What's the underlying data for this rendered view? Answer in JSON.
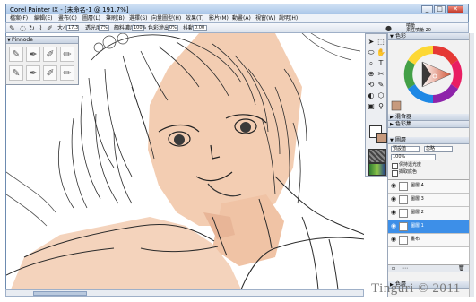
{
  "window": {
    "title": "Corel Painter IX - [未命名-1 @ 191.7%]",
    "controls": [
      "_",
      "□",
      "✕"
    ]
  },
  "menubar": {
    "items": [
      "檔案(F)",
      "編輯(E)",
      "畫布(C)",
      "圖層(L)",
      "筆刷(B)",
      "選擇(S)",
      "向量圖型(H)",
      "效果(T)",
      "影片(M)",
      "動畫(A)",
      "視窗(W)",
      "說明(H)"
    ]
  },
  "property_bar": {
    "size_label": "大小",
    "size_value": "17.3",
    "opacity_label": "透光度",
    "opacity_value": "7%",
    "resat_label": "顏料濃度",
    "resat_value": "100%",
    "bleed_label": "色彩滲出",
    "bleed_value": "0%",
    "jitter_label": "抖動",
    "jitter_value": "0.00",
    "brush_category": "噴槍",
    "brush_variant": "柔性噴槍 20"
  },
  "brush_panel": {
    "title": "Pinnode",
    "cells": [
      "✎",
      "✒",
      "✐",
      "✏",
      "✎",
      "✒",
      "✐",
      "✏"
    ]
  },
  "toolbox": {
    "tools": [
      "➤",
      "⬚",
      "⬭",
      "✋",
      "⌕",
      "T",
      "⊕",
      "✂",
      "⟲",
      "✎",
      "◐",
      "⬡",
      "▣",
      "⚲"
    ],
    "main_color": "#ffffff",
    "sub_color": "#c79a7d"
  },
  "panels": {
    "color": {
      "title": "色彩",
      "hue_swatch": "#c79a7d"
    },
    "mixer": {
      "title": "混合器"
    },
    "color_set": {
      "title": "色彩集"
    },
    "layers": {
      "title": "圖層",
      "composite_method": "預設值",
      "composite_mode": "忽略",
      "opacity": "100%",
      "preserve_label": "保持透光度",
      "pick_up_label": "擷取底色",
      "items": [
        {
          "name": "圖層 4",
          "visible": true,
          "selected": false
        },
        {
          "name": "圖層 3",
          "visible": true,
          "selected": false
        },
        {
          "name": "圖層 2",
          "visible": true,
          "selected": false
        },
        {
          "name": "圖層 1",
          "visible": true,
          "selected": true
        },
        {
          "name": "畫布",
          "visible": true,
          "selected": false
        }
      ]
    },
    "bottom_tab": {
      "title": "色層"
    }
  },
  "watermark": "Tinguri © 2011",
  "colors": {
    "skin": "#f1c9ad",
    "line": "#2b2b2b",
    "accent": "#3d8fe8"
  }
}
